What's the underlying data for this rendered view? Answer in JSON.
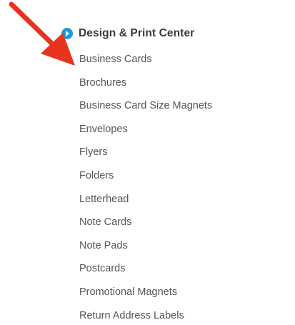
{
  "section": {
    "title": "Design & Print Center",
    "icon": "play-bullet-icon",
    "icon_color": "#1e9ad6"
  },
  "arrow": {
    "icon": "red-arrow-pointer-icon",
    "color": "#e8341c"
  },
  "nav_items": [
    {
      "label": "Business Cards"
    },
    {
      "label": "Brochures"
    },
    {
      "label": "Business Card Size Magnets"
    },
    {
      "label": "Envelopes"
    },
    {
      "label": "Flyers"
    },
    {
      "label": "Folders"
    },
    {
      "label": "Letterhead"
    },
    {
      "label": "Note Cards"
    },
    {
      "label": "Note Pads"
    },
    {
      "label": "Postcards"
    },
    {
      "label": "Promotional Magnets"
    },
    {
      "label": "Return Address Labels"
    }
  ]
}
